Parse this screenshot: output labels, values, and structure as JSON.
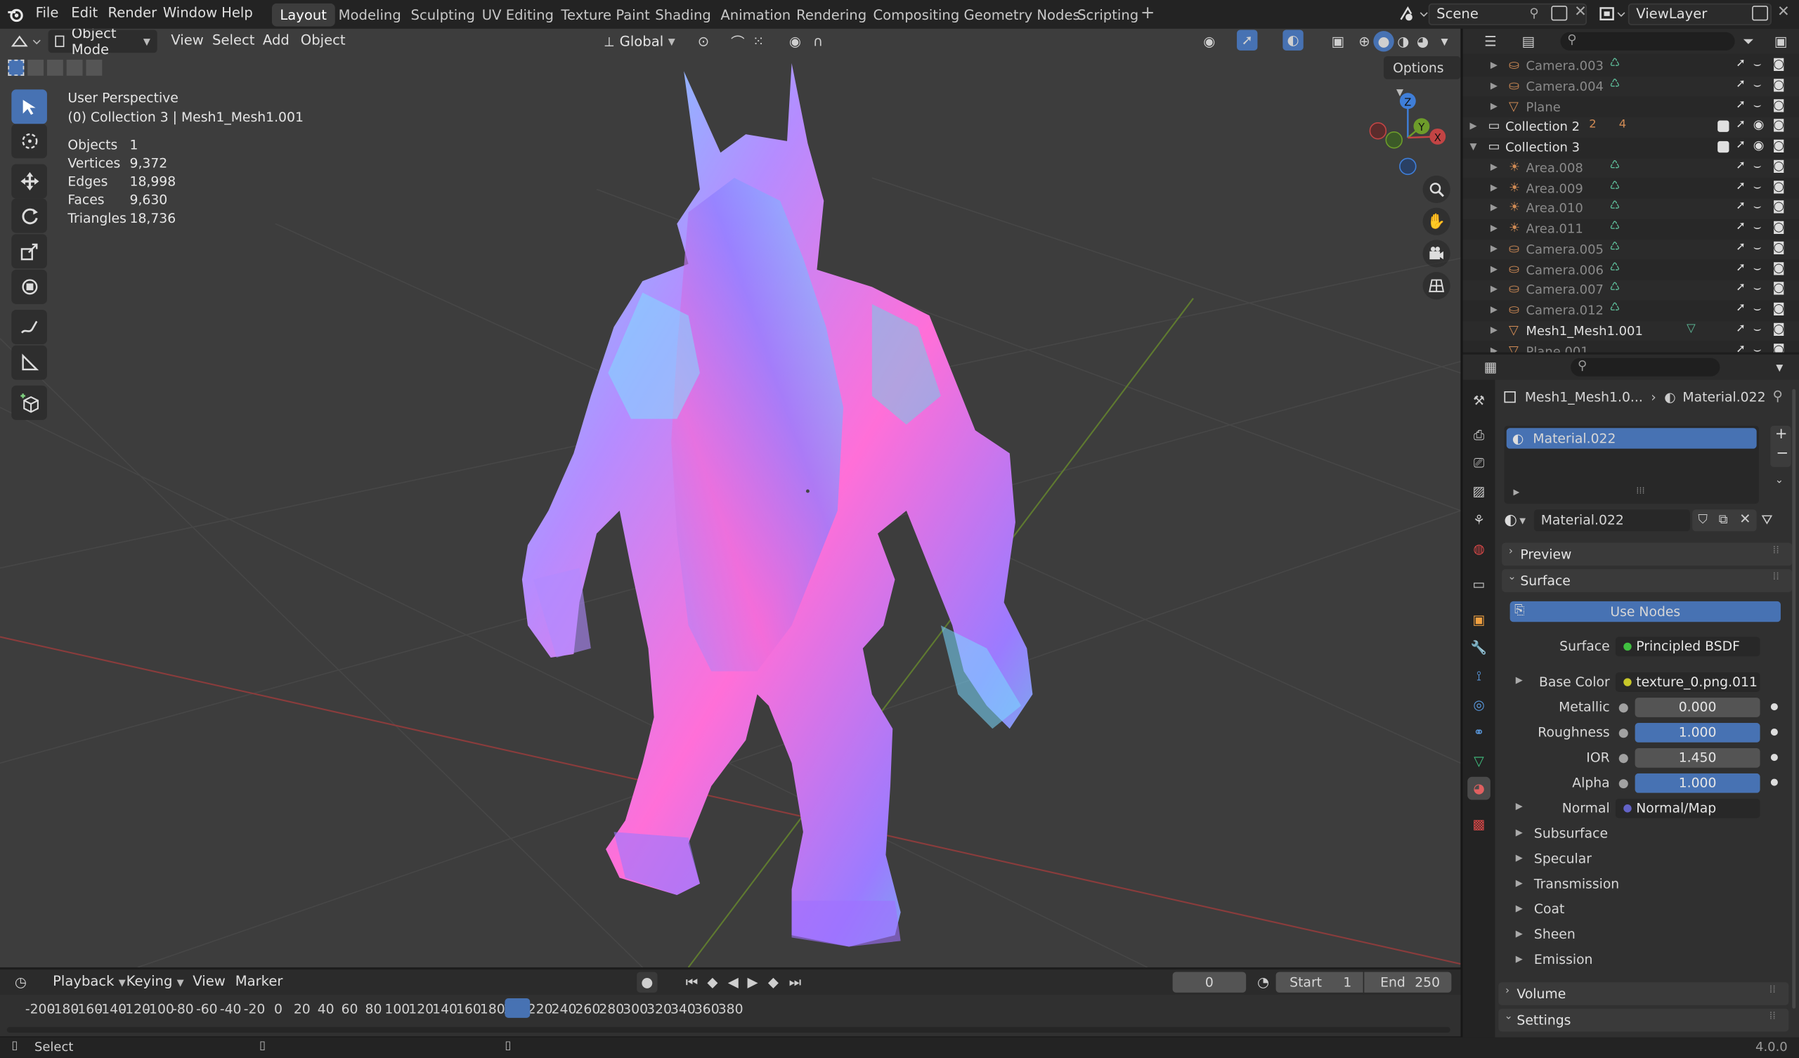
{
  "app": {
    "version": "4.0.0",
    "menus": [
      "File",
      "Edit",
      "Render",
      "Window",
      "Help"
    ],
    "workspace_tabs": [
      "Layout",
      "Modeling",
      "Sculpting",
      "UV Editing",
      "Texture Paint",
      "Shading",
      "Animation",
      "Rendering",
      "Compositing",
      "Geometry Nodes",
      "Scripting"
    ],
    "active_tab": "Layout",
    "scene": "Scene",
    "view_layer": "ViewLayer"
  },
  "viewport": {
    "mode": "Object Mode",
    "menus": [
      "View",
      "Select",
      "Add",
      "Object"
    ],
    "orientation": "Global",
    "options_label": "Options",
    "view_name": "User Perspective",
    "collection_line": "(0) Collection 3 | Mesh1_Mesh1.001",
    "stats": [
      {
        "label": "Objects",
        "value": "1"
      },
      {
        "label": "Vertices",
        "value": "9,372"
      },
      {
        "label": "Edges",
        "value": "18,998"
      },
      {
        "label": "Faces",
        "value": "9,630"
      },
      {
        "label": "Triangles",
        "value": "18,736"
      }
    ],
    "gizmo_axes": {
      "z": "Z",
      "y": "Y",
      "x": "X"
    }
  },
  "outliner": {
    "rows": [
      {
        "label": "Camera.003",
        "type": "camera",
        "indent": 2,
        "dim": true
      },
      {
        "label": "Camera.004",
        "type": "camera",
        "indent": 2,
        "dim": true
      },
      {
        "label": "Plane",
        "type": "mesh",
        "indent": 2,
        "dim": true
      },
      {
        "label": "Collection 2",
        "type": "collection",
        "indent": 1,
        "dim": false,
        "badges": [
          "2",
          "4"
        ]
      },
      {
        "label": "Collection 3",
        "type": "collection",
        "indent": 1,
        "dim": false,
        "expanded": true
      },
      {
        "label": "Area.008",
        "type": "light",
        "indent": 2,
        "dim": true
      },
      {
        "label": "Area.009",
        "type": "light",
        "indent": 2,
        "dim": true
      },
      {
        "label": "Area.010",
        "type": "light",
        "indent": 2,
        "dim": true
      },
      {
        "label": "Area.011",
        "type": "light",
        "indent": 2,
        "dim": true
      },
      {
        "label": "Camera.005",
        "type": "camera",
        "indent": 2,
        "dim": true
      },
      {
        "label": "Camera.006",
        "type": "camera",
        "indent": 2,
        "dim": true
      },
      {
        "label": "Camera.007",
        "type": "camera",
        "indent": 2,
        "dim": true
      },
      {
        "label": "Camera.012",
        "type": "camera",
        "indent": 2,
        "dim": true
      },
      {
        "label": "Mesh1_Mesh1.001",
        "type": "mesh",
        "indent": 2,
        "dim": false
      },
      {
        "label": "Plane.001",
        "type": "mesh",
        "indent": 2,
        "dim": true
      }
    ]
  },
  "properties": {
    "breadcrumb_object": "Mesh1_Mesh1.0...",
    "breadcrumb_material": "Material.022",
    "slot_name": "Material.022",
    "material_name": "Material.022",
    "panels": {
      "preview": "Preview",
      "surface": "Surface",
      "volume": "Volume",
      "settings": "Settings"
    },
    "use_nodes": "Use Nodes",
    "surface_label": "Surface",
    "surface_value": "Principled BSDF",
    "inputs": [
      {
        "label": "Base Color",
        "value": "texture_0.png.011",
        "kind": "node",
        "socket": "#c7c729",
        "expand": true
      },
      {
        "label": "Metallic",
        "value": "0.000",
        "kind": "num",
        "fill": 0.0
      },
      {
        "label": "Roughness",
        "value": "1.000",
        "kind": "num",
        "fill": 1.0
      },
      {
        "label": "IOR",
        "value": "1.450",
        "kind": "num",
        "fill": 0.0
      },
      {
        "label": "Alpha",
        "value": "1.000",
        "kind": "num",
        "fill": 1.0
      },
      {
        "label": "Normal",
        "value": "Normal/Map",
        "kind": "node",
        "socket": "#6363c7",
        "expand": true
      }
    ],
    "subpanels": [
      "Subsurface",
      "Specular",
      "Transmission",
      "Coat",
      "Sheen",
      "Emission"
    ]
  },
  "timeline": {
    "menus": [
      "Playback",
      "Keying",
      "View",
      "Marker"
    ],
    "current_frame": "0",
    "start_label": "Start",
    "start": "1",
    "end_label": "End",
    "end": "250",
    "ticks": [
      "-200",
      "-180",
      "-160",
      "-140",
      "-120",
      "-100",
      "-80",
      "-60",
      "-40",
      "-20",
      "0",
      "20",
      "40",
      "60",
      "80",
      "100",
      "120",
      "140",
      "160",
      "180",
      "200",
      "220",
      "240",
      "260",
      "280",
      "300",
      "320",
      "340",
      "360",
      "380"
    ]
  },
  "status": {
    "left": "Select"
  },
  "colors": {
    "accent": "#4772b3",
    "x_axis": "#c24444",
    "y_axis": "#6d9c2a",
    "z_axis": "#3f7ed8",
    "camera_icon": "#d18b55",
    "mesh_icon": "#5fc09c"
  }
}
